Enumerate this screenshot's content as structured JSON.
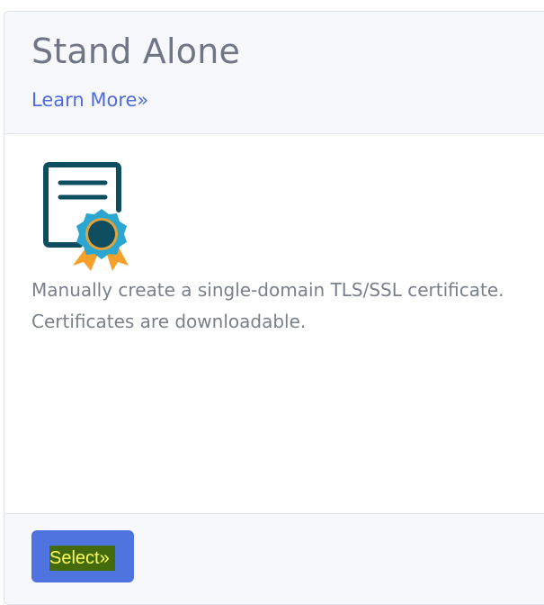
{
  "card": {
    "title": "Stand Alone",
    "learn_more_label": "Learn More»",
    "icon": "certificate-with-award-ribbon-icon",
    "description": "Manually create a single-domain TLS/SSL certificate. Certificates are downloadable.",
    "select_label": "Select»"
  },
  "colors": {
    "title_text": "#707686",
    "link": "#4f6bd8",
    "description_text": "#7a7f8c",
    "header_footer_bg": "#f7f8fc",
    "button_bg": "#4f74e0",
    "button_highlight_bg": "#436b0c",
    "button_highlight_text": "#ffff5a",
    "icon_dark_teal": "#0d4d5f",
    "icon_light_blue": "#2aa6d1",
    "icon_orange": "#f5a02a"
  }
}
